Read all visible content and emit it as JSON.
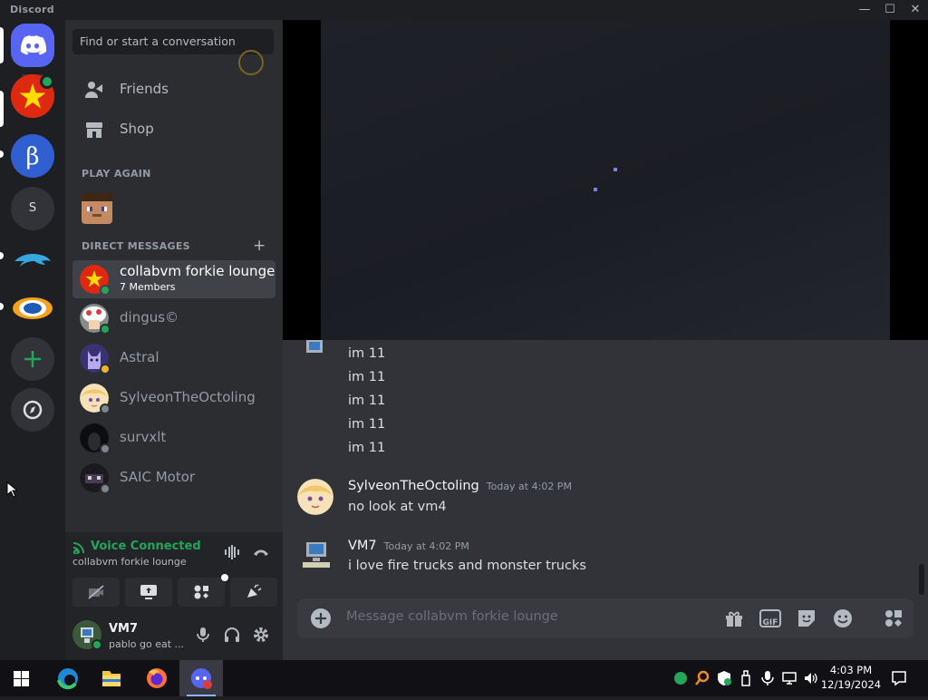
{
  "titlebar": {
    "app_name": "Discord",
    "minimize": "—",
    "maximize": "☐",
    "close": "✕"
  },
  "search": {
    "placeholder": "Find or start a conversation"
  },
  "nav": {
    "friends": "Friends",
    "shop": "Shop"
  },
  "sections": {
    "play_again": "PLAY AGAIN",
    "direct_messages": "DIRECT MESSAGES",
    "add_dm": "+"
  },
  "guild_server_s": "S",
  "dms": [
    {
      "name": "collabvm forkie lounge",
      "subtitle": "7 Members",
      "active": true
    },
    {
      "name": "dingus©"
    },
    {
      "name": "Astral"
    },
    {
      "name": "SylveonTheOctoling"
    },
    {
      "name": "survxlt"
    },
    {
      "name": "SAIC Motor"
    }
  ],
  "voice": {
    "status": "Voice Connected",
    "channel": "collabvm forkie lounge"
  },
  "user": {
    "name": "VM7",
    "status": "pablo go eat ..."
  },
  "messages": {
    "repeated_lines": [
      "im 11",
      "im 11",
      "im 11",
      "im 11",
      "im 11"
    ],
    "msg1": {
      "author": "SylveonTheOctoling",
      "timestamp": "Today at 4:02 PM",
      "text": "no look at vm4"
    },
    "msg2": {
      "author": "VM7",
      "timestamp": "Today at 4:02 PM",
      "text": "i love fire trucks and monster trucks"
    }
  },
  "composer": {
    "placeholder": "Message collabvm forkie lounge",
    "gif_label": "GIF"
  },
  "taskbar": {
    "time": "4:03 PM",
    "date": "12/19/2024"
  },
  "colors": {
    "accent": "#5865f2",
    "online": "#23a55a",
    "voice_green": "#23a55a",
    "bg": "#313338"
  }
}
